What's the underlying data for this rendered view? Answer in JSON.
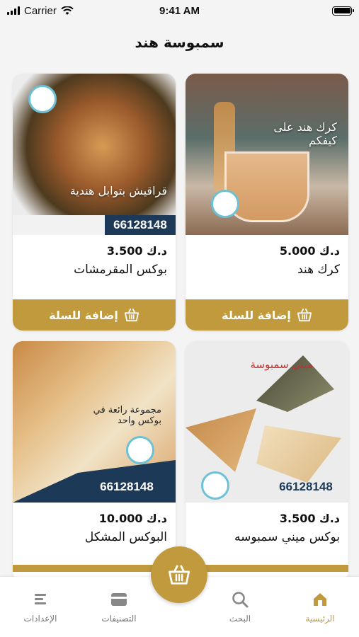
{
  "status": {
    "carrier": "Carrier",
    "time": "9:41 AM"
  },
  "header": {
    "title": "سمبوسة هند"
  },
  "products": [
    {
      "name": "كرك هند",
      "price": "5.000",
      "currency": "د.ك",
      "add_label": "إضافة للسلة",
      "overlay": "كرك هند على كيفكم"
    },
    {
      "name": "بوكس المقرمشات",
      "price": "3.500",
      "currency": "د.ك",
      "add_label": "إضافة للسلة",
      "overlay": "قراقيش بتوابل هندية",
      "phone": "66128148"
    },
    {
      "name": "بوكس ميني سمبوسه",
      "price": "3.500",
      "currency": "د.ك",
      "overlay": "ميني سمبوسة",
      "phone": "66128148"
    },
    {
      "name": "البوكس المشكل",
      "price": "10.000",
      "currency": "د.ك",
      "overlay": "مجموعة رائعة في بوكس واحد",
      "phone": "66128148"
    }
  ],
  "tabs": [
    {
      "label": "الرئيسية",
      "icon": "home-icon",
      "active": true
    },
    {
      "label": "البحث",
      "icon": "search-icon"
    },
    {
      "label": "التصنيفات",
      "icon": "categories-icon"
    },
    {
      "label": "الإعدادات",
      "icon": "settings-icon"
    }
  ],
  "colors": {
    "accent": "#c09a3c",
    "brand_blue": "#1c3a57"
  }
}
